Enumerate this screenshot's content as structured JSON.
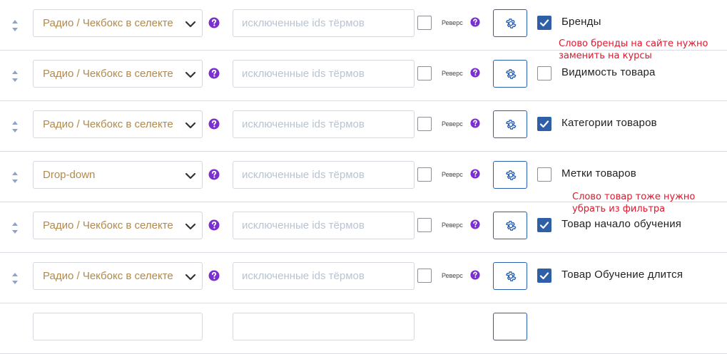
{
  "colors": {
    "accent": "#2f5fa7",
    "select_text": "#b08a4e",
    "placeholder": "#b8c4d1",
    "help_icon": "#7b2fd0",
    "annotation": "#e0162b",
    "border": "#d5d8de"
  },
  "rows": [
    {
      "select": "Радио / Чекбокс в селекте",
      "placeholder": "исключенные ids тёрмов",
      "reverse": "Реверс",
      "enabled": true,
      "label": "Бренды"
    },
    {
      "select": "Радио / Чекбокс в селекте",
      "placeholder": "исключенные ids тёрмов",
      "reverse": "Реверс",
      "enabled": false,
      "label": "Видимость товара"
    },
    {
      "select": "Радио / Чекбокс в селекте",
      "placeholder": "исключенные ids тёрмов",
      "reverse": "Реверс",
      "enabled": true,
      "label": "Категории товаров"
    },
    {
      "select": "Drop-down",
      "placeholder": "исключенные ids тёрмов",
      "reverse": "Реверс",
      "enabled": false,
      "label": "Метки товаров"
    },
    {
      "select": "Радио / Чекбокс в селекте",
      "placeholder": "исключенные ids тёрмов",
      "reverse": "Реверс",
      "enabled": true,
      "label": "Товар начало обучения"
    },
    {
      "select": "Радио / Чекбокс в селекте",
      "placeholder": "исключенные ids тёрмов",
      "reverse": "Реверс",
      "enabled": true,
      "label": "Товар Обучение длится"
    }
  ],
  "annotations": {
    "note1": {
      "line1": "Слово бренды на сайте нужно",
      "line2": "заменить на курсы"
    },
    "note2": {
      "line1": "Слово товар тоже нужно",
      "line2": "убрать из фильтра"
    }
  }
}
